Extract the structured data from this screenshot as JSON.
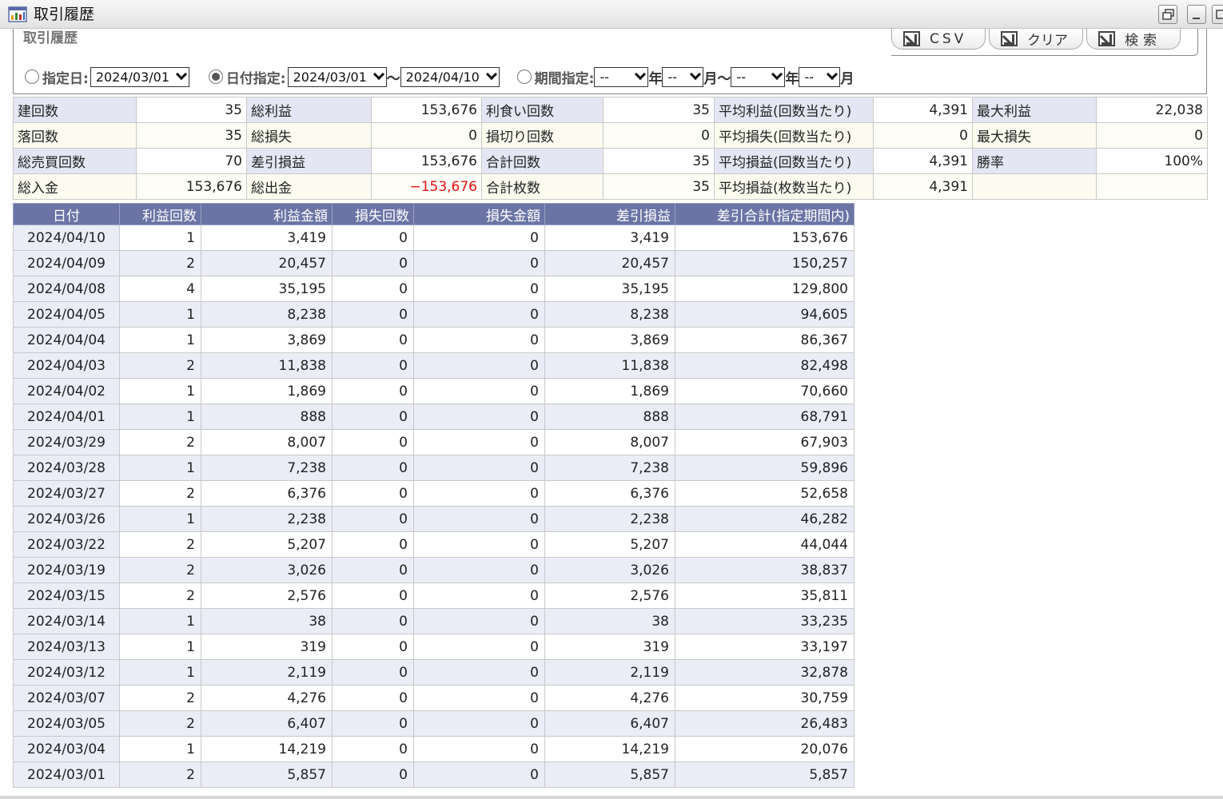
{
  "window": {
    "title": "取引履歴"
  },
  "panel": {
    "title": "取引履歴",
    "buttons": {
      "csv": "CSV",
      "clear": "クリア",
      "search": "検索"
    }
  },
  "filters": {
    "specified_date": {
      "label": "指定日:",
      "value": "2024/03/01",
      "checked": false
    },
    "date_range": {
      "label": "日付指定:",
      "from": "2024/03/01",
      "sep": "〜",
      "to": "2024/04/10",
      "checked": true
    },
    "period": {
      "label": "期間指定:",
      "year1": "--",
      "unit_year": "年",
      "month1": "--",
      "unit_month_sep": "月〜",
      "year2": "--",
      "month2": "--",
      "unit_month": "月",
      "checked": false
    }
  },
  "summary": [
    [
      {
        "label": "建回数",
        "value": "35"
      },
      {
        "label": "総利益",
        "value": "153,676"
      },
      {
        "label": "利食い回数",
        "value": "35"
      },
      {
        "label": "平均利益(回数当たり)",
        "value": "4,391"
      },
      {
        "label": "最大利益",
        "value": "22,038"
      }
    ],
    [
      {
        "label": "落回数",
        "value": "35"
      },
      {
        "label": "総損失",
        "value": "0"
      },
      {
        "label": "損切り回数",
        "value": "0"
      },
      {
        "label": "平均損失(回数当たり)",
        "value": "0"
      },
      {
        "label": "最大損失",
        "value": "0"
      }
    ],
    [
      {
        "label": "総売買回数",
        "value": "70"
      },
      {
        "label": "差引損益",
        "value": "153,676"
      },
      {
        "label": "合計回数",
        "value": "35"
      },
      {
        "label": "平均損益(回数当たり)",
        "value": "4,391"
      },
      {
        "label": "勝率",
        "value": "100%"
      }
    ],
    [
      {
        "label": "総入金",
        "value": "153,676"
      },
      {
        "label": "総出金",
        "value": "−153,676"
      },
      {
        "label": "合計枚数",
        "value": "35"
      },
      {
        "label": "平均損益(枚数当たり)",
        "value": "4,391"
      },
      {
        "label": "",
        "value": ""
      }
    ]
  ],
  "table": {
    "headers": [
      "日付",
      "利益回数",
      "利益金額",
      "損失回数",
      "損失金額",
      "差引損益",
      "差引合計(指定期間内)"
    ],
    "rows": [
      [
        "2024/04/10",
        "1",
        "3,419",
        "0",
        "0",
        "3,419",
        "153,676"
      ],
      [
        "2024/04/09",
        "2",
        "20,457",
        "0",
        "0",
        "20,457",
        "150,257"
      ],
      [
        "2024/04/08",
        "4",
        "35,195",
        "0",
        "0",
        "35,195",
        "129,800"
      ],
      [
        "2024/04/05",
        "1",
        "8,238",
        "0",
        "0",
        "8,238",
        "94,605"
      ],
      [
        "2024/04/04",
        "1",
        "3,869",
        "0",
        "0",
        "3,869",
        "86,367"
      ],
      [
        "2024/04/03",
        "2",
        "11,838",
        "0",
        "0",
        "11,838",
        "82,498"
      ],
      [
        "2024/04/02",
        "1",
        "1,869",
        "0",
        "0",
        "1,869",
        "70,660"
      ],
      [
        "2024/04/01",
        "1",
        "888",
        "0",
        "0",
        "888",
        "68,791"
      ],
      [
        "2024/03/29",
        "2",
        "8,007",
        "0",
        "0",
        "8,007",
        "67,903"
      ],
      [
        "2024/03/28",
        "1",
        "7,238",
        "0",
        "0",
        "7,238",
        "59,896"
      ],
      [
        "2024/03/27",
        "2",
        "6,376",
        "0",
        "0",
        "6,376",
        "52,658"
      ],
      [
        "2024/03/26",
        "1",
        "2,238",
        "0",
        "0",
        "2,238",
        "46,282"
      ],
      [
        "2024/03/22",
        "2",
        "5,207",
        "0",
        "0",
        "5,207",
        "44,044"
      ],
      [
        "2024/03/19",
        "2",
        "3,026",
        "0",
        "0",
        "3,026",
        "38,837"
      ],
      [
        "2024/03/15",
        "2",
        "2,576",
        "0",
        "0",
        "2,576",
        "35,811"
      ],
      [
        "2024/03/14",
        "1",
        "38",
        "0",
        "0",
        "38",
        "33,235"
      ],
      [
        "2024/03/13",
        "1",
        "319",
        "0",
        "0",
        "319",
        "33,197"
      ],
      [
        "2024/03/12",
        "1",
        "2,119",
        "0",
        "0",
        "2,119",
        "32,878"
      ],
      [
        "2024/03/07",
        "2",
        "4,276",
        "0",
        "0",
        "4,276",
        "30,759"
      ],
      [
        "2024/03/05",
        "2",
        "6,407",
        "0",
        "0",
        "6,407",
        "26,483"
      ],
      [
        "2024/03/04",
        "1",
        "14,219",
        "0",
        "0",
        "14,219",
        "20,076"
      ],
      [
        "2024/03/01",
        "2",
        "5,857",
        "0",
        "0",
        "5,857",
        "5,857"
      ]
    ]
  },
  "icons": {
    "app": "chart-window-icon",
    "restore": "restore-icon",
    "minimize": "minimize-icon",
    "maximize": "maximize-icon",
    "action": "arrow-box-icon"
  },
  "colors": {
    "header_bg": "#6b74a4",
    "label_bg": "#e4e6f3",
    "negative": "#e01010"
  }
}
